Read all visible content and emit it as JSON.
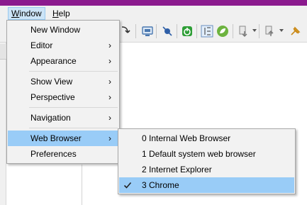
{
  "menubar": {
    "window_label": "Window",
    "window_mnemonic": "W",
    "window_rest": "indow",
    "help_label": "Help",
    "help_mnemonic": "H",
    "help_rest": "elp"
  },
  "window_menu": {
    "items": [
      {
        "label": "New Window",
        "submenu": false
      },
      {
        "label": "Editor",
        "submenu": true
      },
      {
        "label": "Appearance",
        "submenu": true
      },
      {
        "label": "Show View",
        "submenu": true
      },
      {
        "label": "Perspective",
        "submenu": true
      },
      {
        "label": "Navigation",
        "submenu": true
      },
      {
        "label": "Web Browser",
        "submenu": true,
        "highlighted": true
      },
      {
        "label": "Preferences",
        "submenu": false
      }
    ],
    "arrow_glyph": "›"
  },
  "web_browser_menu": {
    "items": [
      {
        "label": "0 Internal Web Browser",
        "checked": false
      },
      {
        "label": "1 Default system web browser",
        "checked": false
      },
      {
        "label": "2 Internet Explorer",
        "checked": false
      },
      {
        "label": "3 Chrome",
        "checked": true,
        "highlighted": true
      }
    ]
  },
  "toolbar": {
    "icons": [
      "toolbar-arrow-icon",
      "monitor-icon",
      "breakpoint-skip-icon",
      "spring-boot-icon",
      "toggle-layout-icon",
      "spring-leaf-icon",
      "download-icon",
      "next-annotation-icon",
      "pin-icon"
    ]
  },
  "colors": {
    "title_strip": "#8b1a8e",
    "menubar_active": "#cce4f7",
    "highlight": "#99ccf7",
    "menu_bg": "#f2f2f2"
  }
}
